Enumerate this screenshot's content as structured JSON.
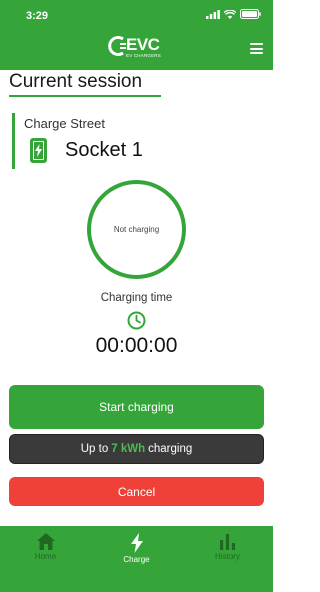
{
  "status_bar": {
    "time": "3:29"
  },
  "brand": {
    "logo_text": "EVC",
    "logo_sub": "EV CHARGERS"
  },
  "page": {
    "title": "Current session"
  },
  "station": {
    "name": "Charge Street",
    "socket": "Socket 1"
  },
  "session": {
    "status": "Not charging",
    "time_label": "Charging time",
    "time_value": "00:00:00"
  },
  "actions": {
    "start_label": "Start charging",
    "limit_prefix": "Up to",
    "limit_value": "7 kWh",
    "limit_suffix": "charging",
    "cancel_label": "Cancel"
  },
  "tabs": [
    {
      "label": "Home",
      "icon": "home-icon",
      "active": false
    },
    {
      "label": "Charge",
      "icon": "charge-icon",
      "active": true
    },
    {
      "label": "History",
      "icon": "history-icon",
      "active": false
    }
  ],
  "colors": {
    "brand_green": "#35a53a",
    "cancel_red": "#ef4138",
    "dark_button": "#3a3a3a",
    "highlight_green": "#4cbb50"
  }
}
